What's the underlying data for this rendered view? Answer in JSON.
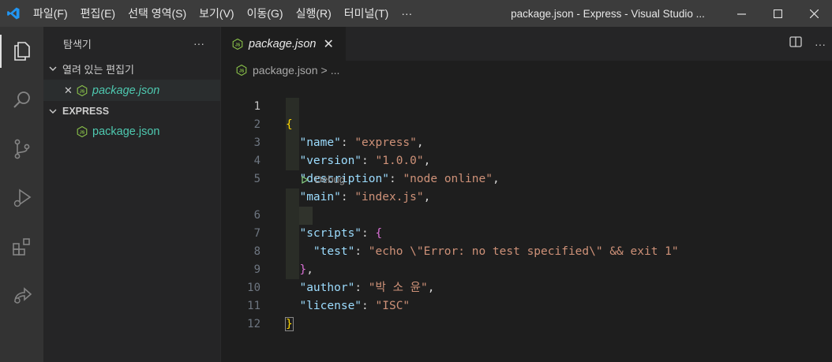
{
  "titlebar": {
    "menu": [
      "파일(F)",
      "편집(E)",
      "선택 영역(S)",
      "보기(V)",
      "이동(G)",
      "실행(R)",
      "터미널(T)",
      "···"
    ],
    "window_title": "package.json - Express - Visual Studio ..."
  },
  "sidebar": {
    "title": "탐색기",
    "more": "···",
    "open_editors_label": "열려 있는 편집기",
    "open_editor_file": "package.json",
    "close_glyph": "✕",
    "folder_label": "EXPRESS",
    "folder_file": "package.json"
  },
  "editor": {
    "tab_label": "package.json",
    "tab_close": "✕",
    "more": "···",
    "breadcrumb": {
      "file": "package.json",
      "sep": ">",
      "rest": "..."
    },
    "codelens": "Debug",
    "line_numbers": [
      "1",
      "2",
      "3",
      "4",
      "5",
      "6",
      "7",
      "8",
      "9",
      "10",
      "11",
      "12"
    ],
    "code": {
      "name_key": "\"name\"",
      "name_val": "\"express\"",
      "version_key": "\"version\"",
      "version_val": "\"1.0.0\"",
      "description_key": "\"description\"",
      "description_val": "\"node online\"",
      "main_key": "\"main\"",
      "main_val": "\"index.js\"",
      "scripts_key": "\"scripts\"",
      "test_key": "\"test\"",
      "test_val": "\"echo \\\"Error: no test specified\\\" && exit 1\"",
      "author_key": "\"author\"",
      "author_val": "\"박 소 윤\"",
      "license_key": "\"license\"",
      "license_val": "\"ISC\""
    }
  },
  "colors": {
    "accent": "#007acc",
    "json_icon": "#8bc34a",
    "file_name": "#4ec9b0"
  }
}
